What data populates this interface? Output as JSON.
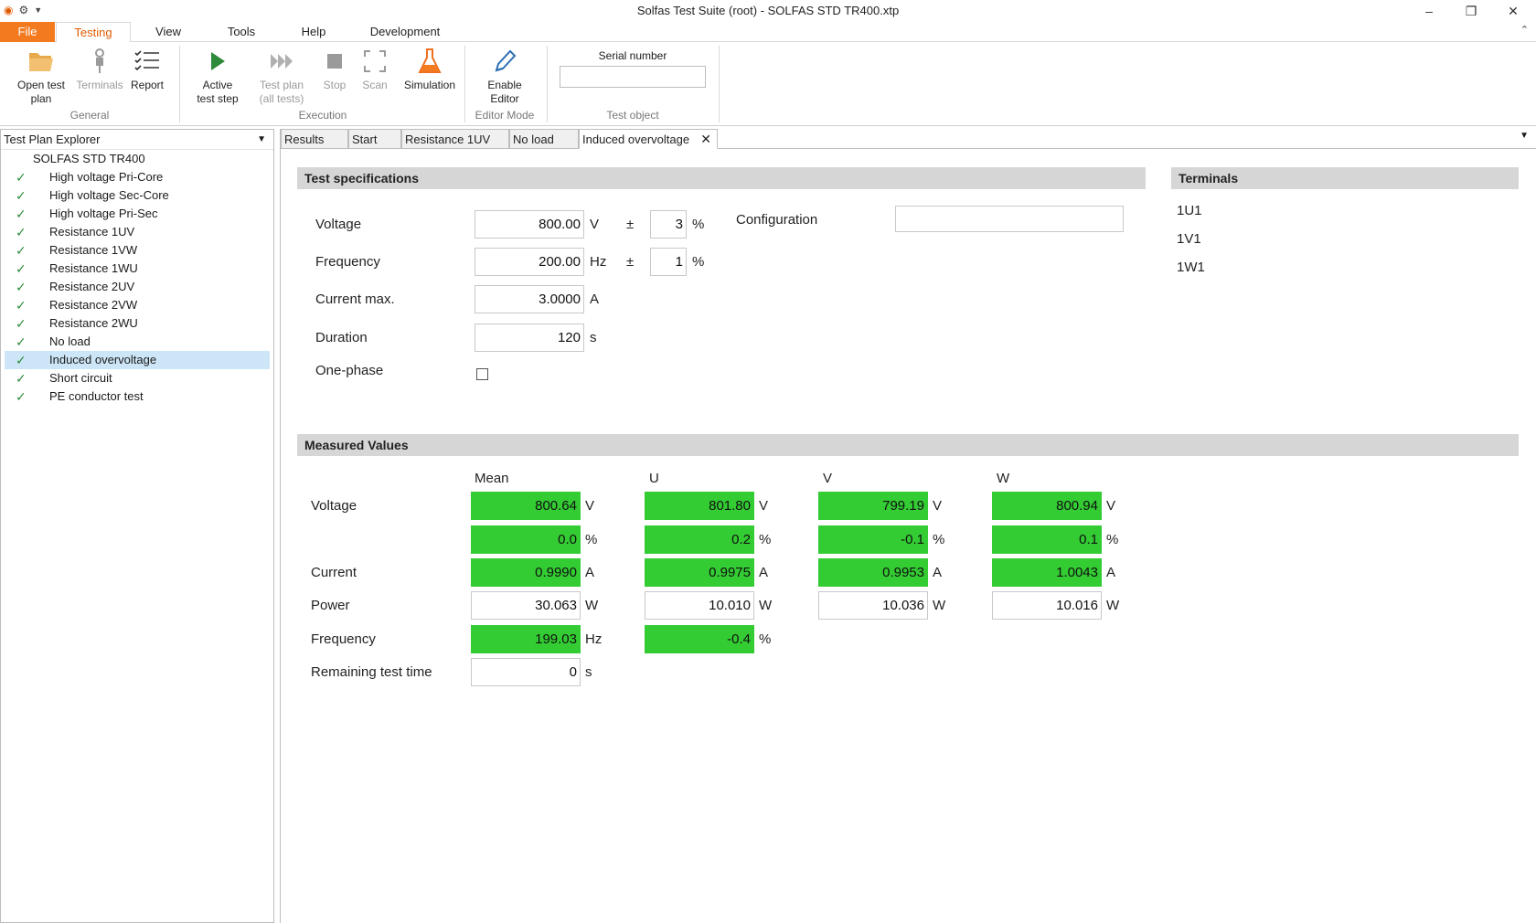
{
  "window": {
    "title": "Solfas Test Suite (root)  - SOLFAS STD TR400.xtp"
  },
  "menu": {
    "file": "File",
    "testing": "Testing",
    "view": "View",
    "tools": "Tools",
    "help": "Help",
    "development": "Development"
  },
  "ribbon": {
    "open_test_plan": "Open test\nplan",
    "open_l1": "Open test",
    "open_l2": "plan",
    "terminals": "Terminals",
    "report": "Report",
    "group_general": "General",
    "active_l1": "Active",
    "active_l2": "test step",
    "testplan_l1": "Test plan",
    "testplan_l2": "(all tests)",
    "stop": "Stop",
    "scan": "Scan",
    "simulation": "Simulation",
    "group_execution": "Execution",
    "enable_l1": "Enable",
    "enable_l2": "Editor",
    "group_editor": "Editor Mode",
    "serial_label": "Serial number",
    "serial_value": "",
    "group_testobject": "Test object"
  },
  "explorer": {
    "title": "Test Plan Explorer",
    "root": "SOLFAS STD TR400",
    "items": [
      "High voltage Pri-Core",
      "High voltage Sec-Core",
      "High voltage Pri-Sec",
      "Resistance 1UV",
      "Resistance 1VW",
      "Resistance 1WU",
      "Resistance 2UV",
      "Resistance 2VW",
      "Resistance 2WU",
      "No load",
      "Induced overvoltage",
      "Short circuit",
      "PE conductor test"
    ],
    "selected_index": 10
  },
  "tabs": [
    "Results",
    "Start",
    "Resistance 1UV",
    "No load",
    "Induced overvoltage"
  ],
  "spec": {
    "title": "Test specifications",
    "voltage_label": "Voltage",
    "voltage_value": "800.00",
    "voltage_unit": "V",
    "voltage_tol": "3",
    "frequency_label": "Frequency",
    "frequency_value": "200.00",
    "frequency_unit": "Hz",
    "frequency_tol": "1",
    "pm": "±",
    "pct": "%",
    "current_label": "Current max.",
    "current_value": "3.0000",
    "current_unit": "A",
    "duration_label": "Duration",
    "duration_value": "120",
    "duration_unit": "s",
    "onephase_label": "One-phase",
    "configuration_label": "Configuration",
    "configuration_value": ""
  },
  "terminals": {
    "title": "Terminals",
    "items": [
      "1U1",
      "1V1",
      "1W1"
    ]
  },
  "measured": {
    "title": "Measured Values",
    "columns": [
      "Mean",
      "U",
      "V",
      "W"
    ],
    "voltage_label": "Voltage",
    "current_label": "Current",
    "power_label": "Power",
    "frequency_label": "Frequency",
    "remaining_label": "Remaining test time",
    "voltage": [
      "800.64",
      "801.80",
      "799.19",
      "800.94"
    ],
    "voltage_unit": "V",
    "voltage_dev": [
      "0.0",
      "0.2",
      "-0.1",
      "0.1"
    ],
    "dev_unit": "%",
    "current": [
      "0.9990",
      "0.9975",
      "0.9953",
      "1.0043"
    ],
    "current_unit": "A",
    "power": [
      "30.063",
      "10.010",
      "10.036",
      "10.016"
    ],
    "power_unit": "W",
    "frequency_mean": "199.03",
    "frequency_unit": "Hz",
    "frequency_dev": "-0.4",
    "remaining": "0",
    "remaining_unit": "s"
  },
  "colors": {
    "accent": "#f47a20",
    "pass_green": "#33cc33",
    "selection": "#cde6f7",
    "section_bar": "#d6d6d6"
  }
}
